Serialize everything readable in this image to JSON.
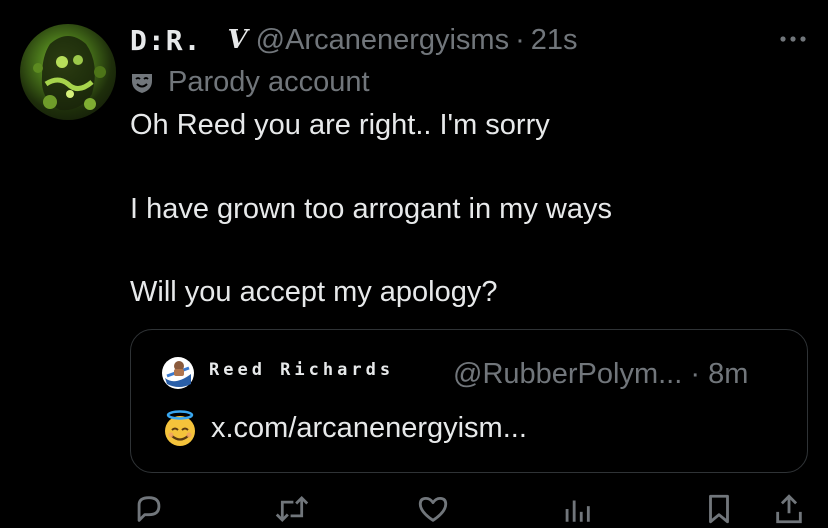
{
  "tweet": {
    "display_name": "D:R.",
    "name_suffix": "V",
    "handle": "@Arcanenergyisms",
    "separator": "·",
    "time": "21s",
    "label": "Parody account",
    "text_lines": [
      "Oh Reed you are right.. I'm sorry",
      "I have grown too arrogant in my ways",
      "Will you accept my apology?"
    ]
  },
  "quoted": {
    "display_name": "Reed Richards",
    "handle": "@RubberPolym...",
    "separator": "·",
    "time": "8m",
    "emoji": "smiling-face-with-halo",
    "link_text": "x.com/arcanenergyism..."
  },
  "actions": [
    "reply-icon",
    "repost-icon",
    "like-icon",
    "views-icon",
    "bookmark-icon",
    "share-icon"
  ],
  "colors": {
    "background": "#000000",
    "primary_text": "#e7e9ea",
    "secondary_text": "#71767b",
    "border": "#2f3336"
  }
}
